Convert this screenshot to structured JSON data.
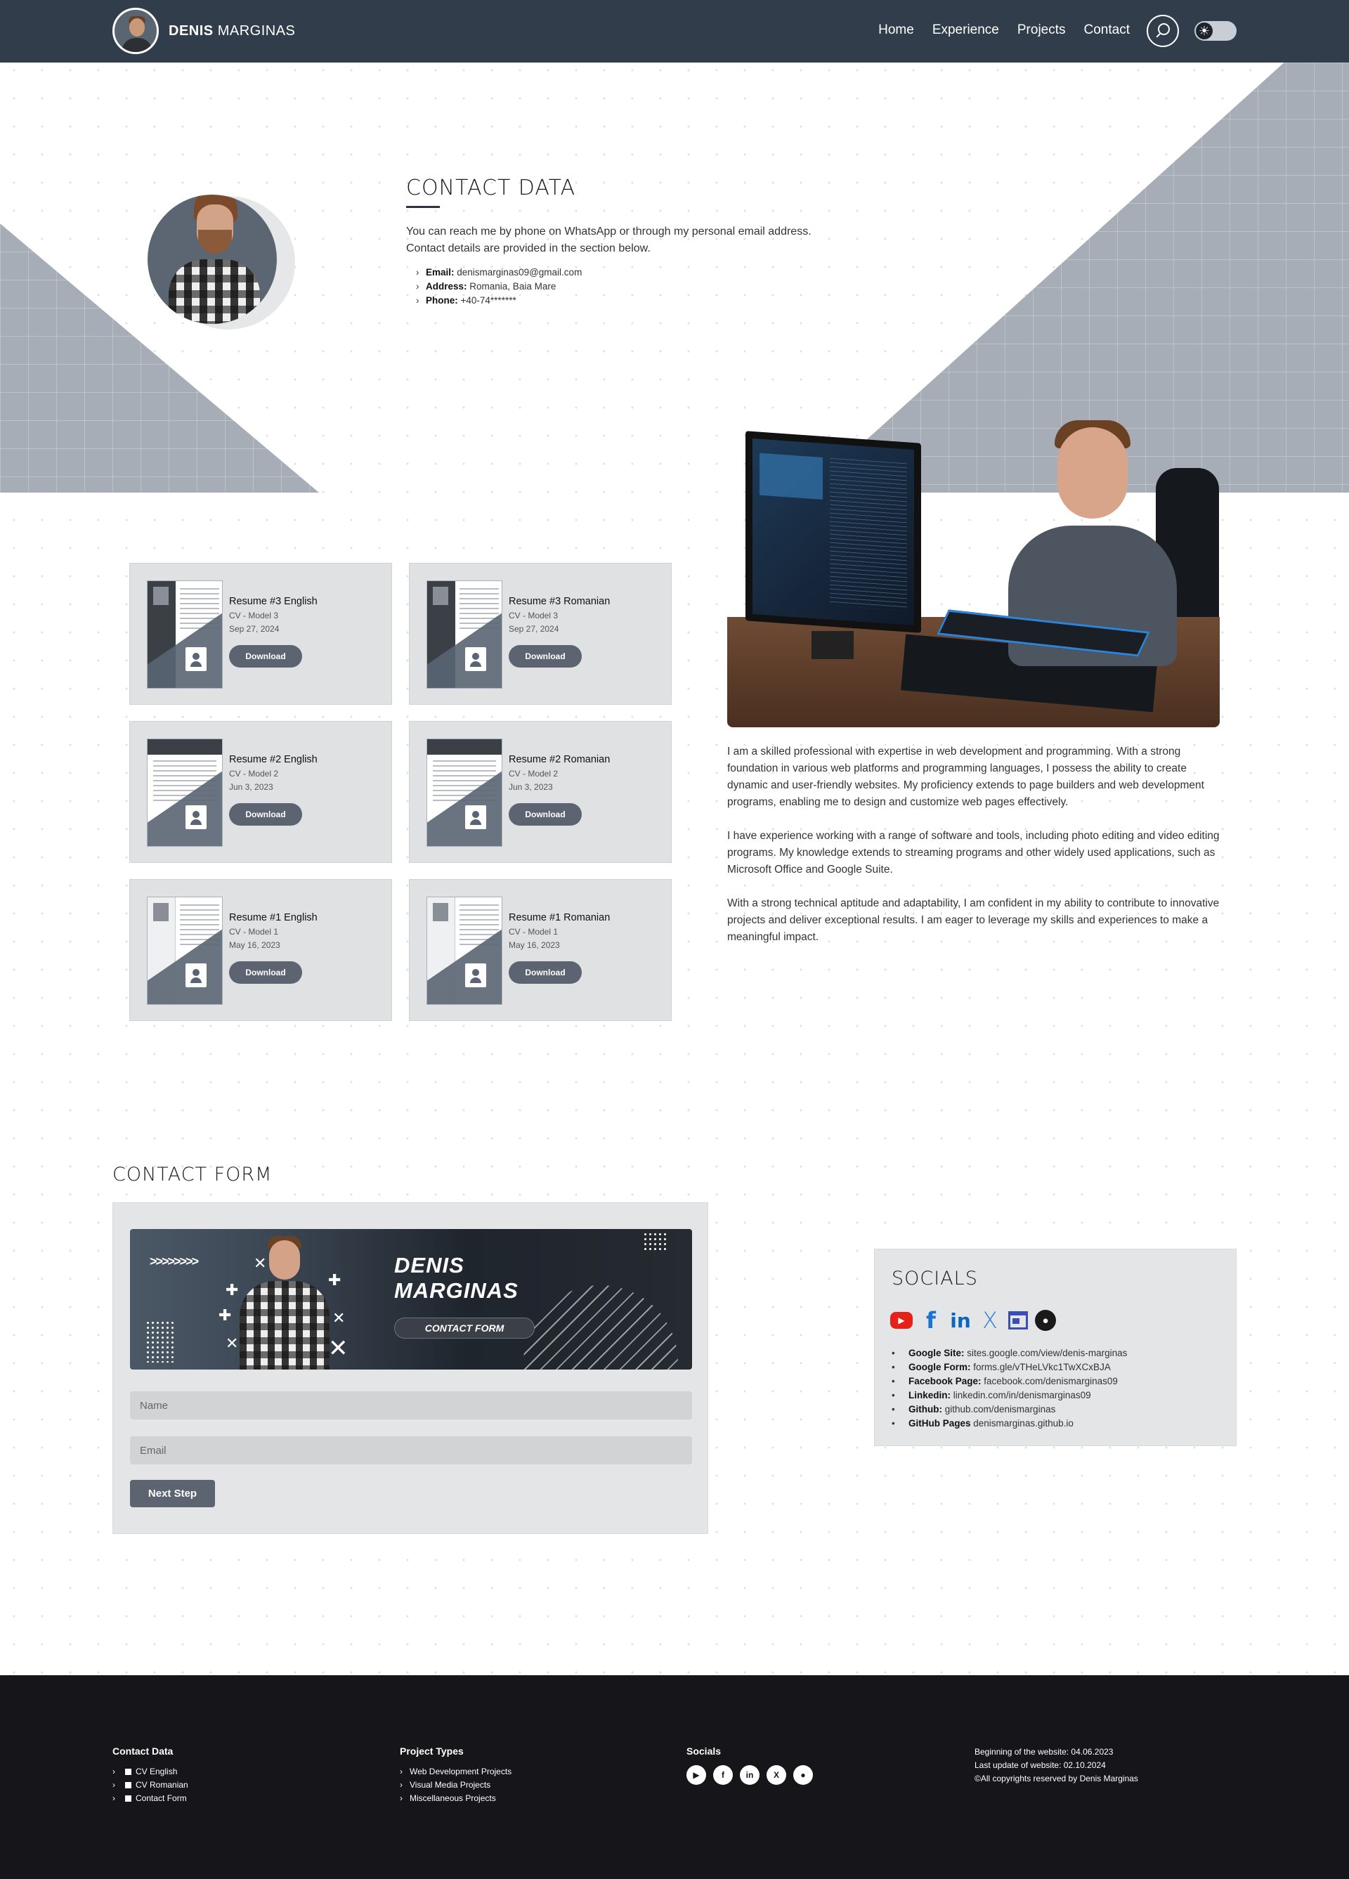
{
  "nav": {
    "brand_first": "Denis",
    "brand_last": "Marginas",
    "links": [
      "Home",
      "Experience",
      "Projects",
      "Contact"
    ]
  },
  "contact": {
    "title": "Contact Data",
    "intro_line1": "You can reach me by phone on WhatsApp or through my personal email address.",
    "intro_line2": "Contact details are provided in the section below.",
    "items": [
      {
        "label": "Email:",
        "value": "denismarginas09@gmail.com"
      },
      {
        "label": "Address:",
        "value": "Romania, Baia Mare"
      },
      {
        "label": "Phone:",
        "value": "+40-74*******"
      }
    ]
  },
  "resumes": [
    {
      "title": "Resume #3 English",
      "model": "CV - Model 3",
      "date": "Sep 27, 2024",
      "button": "Download"
    },
    {
      "title": "Resume #3 Romanian",
      "model": "CV - Model 3",
      "date": "Sep 27, 2024",
      "button": "Download"
    },
    {
      "title": "Resume #2 English",
      "model": "CV - Model 2",
      "date": "Jun 3, 2023",
      "button": "Download"
    },
    {
      "title": "Resume #2 Romanian",
      "model": "CV - Model 2",
      "date": "Jun 3, 2023",
      "button": "Download"
    },
    {
      "title": "Resume #1 English",
      "model": "CV - Model 1",
      "date": "May 16, 2023",
      "button": "Download"
    },
    {
      "title": "Resume #1 Romanian",
      "model": "CV - Model 1",
      "date": "May 16, 2023",
      "button": "Download"
    }
  ],
  "about": [
    "I am a skilled professional with expertise in web development and programming. With a strong foundation in various web platforms and programming languages, I possess the ability to create dynamic and user-friendly websites. My proficiency extends to page builders and web development programs, enabling me to design and customize web pages effectively.",
    "I have experience working with a range of software and tools, including photo editing and video editing programs. My knowledge extends to streaming programs and other widely used applications, such as Microsoft Office and Google Suite.",
    "With a strong technical aptitude and adaptability, I am confident in my ability to contribute to innovative projects and deliver exceptional results. I am eager to leverage my skills and experiences to make a meaningful impact."
  ],
  "contact_form": {
    "title": "Contact Form",
    "banner_name_line1": "DENIS",
    "banner_name_line2": "MARGINAS",
    "banner_button": "CONTACT FORM",
    "name_placeholder": "Name",
    "email_placeholder": "Email",
    "next_button": "Next Step"
  },
  "socials": {
    "title": "Socials",
    "icons": [
      "youtube-icon",
      "facebook-icon",
      "linkedin-icon",
      "x-icon",
      "google-sites-icon",
      "github-icon"
    ],
    "items": [
      {
        "label": "Google Site:",
        "value": "sites.google.com/view/denis-marginas"
      },
      {
        "label": "Google Form:",
        "value": "forms.gle/vTHeLVkc1TwXCxBJA"
      },
      {
        "label": "Facebook Page:",
        "value": "facebook.com/denismarginas09"
      },
      {
        "label": "Linkedin:",
        "value": "linkedin.com/in/denismarginas09"
      },
      {
        "label": "Github:",
        "value": "github.com/denismarginas"
      },
      {
        "label": "GitHub Pages",
        "value": "denismarginas.github.io"
      }
    ]
  },
  "footer": {
    "col1_title": "Contact Data",
    "col1_items": [
      "CV English",
      "CV Romanian",
      "Contact Form"
    ],
    "col2_title": "Project Types",
    "col2_items": [
      "Web Development Projects",
      "Visual Media Projects",
      "Miscellaneous Projects"
    ],
    "col3_title": "Socials",
    "notes": [
      "Beginning of the website: 04.06.2023",
      "Last update of website: 02.10.2024",
      "©All copyrights reserved by Denis Marginas"
    ]
  },
  "colors": {
    "navbar": "#323d4b",
    "accent": "#5b6470",
    "footer": "#15151a",
    "card": "#dfe1e3"
  }
}
